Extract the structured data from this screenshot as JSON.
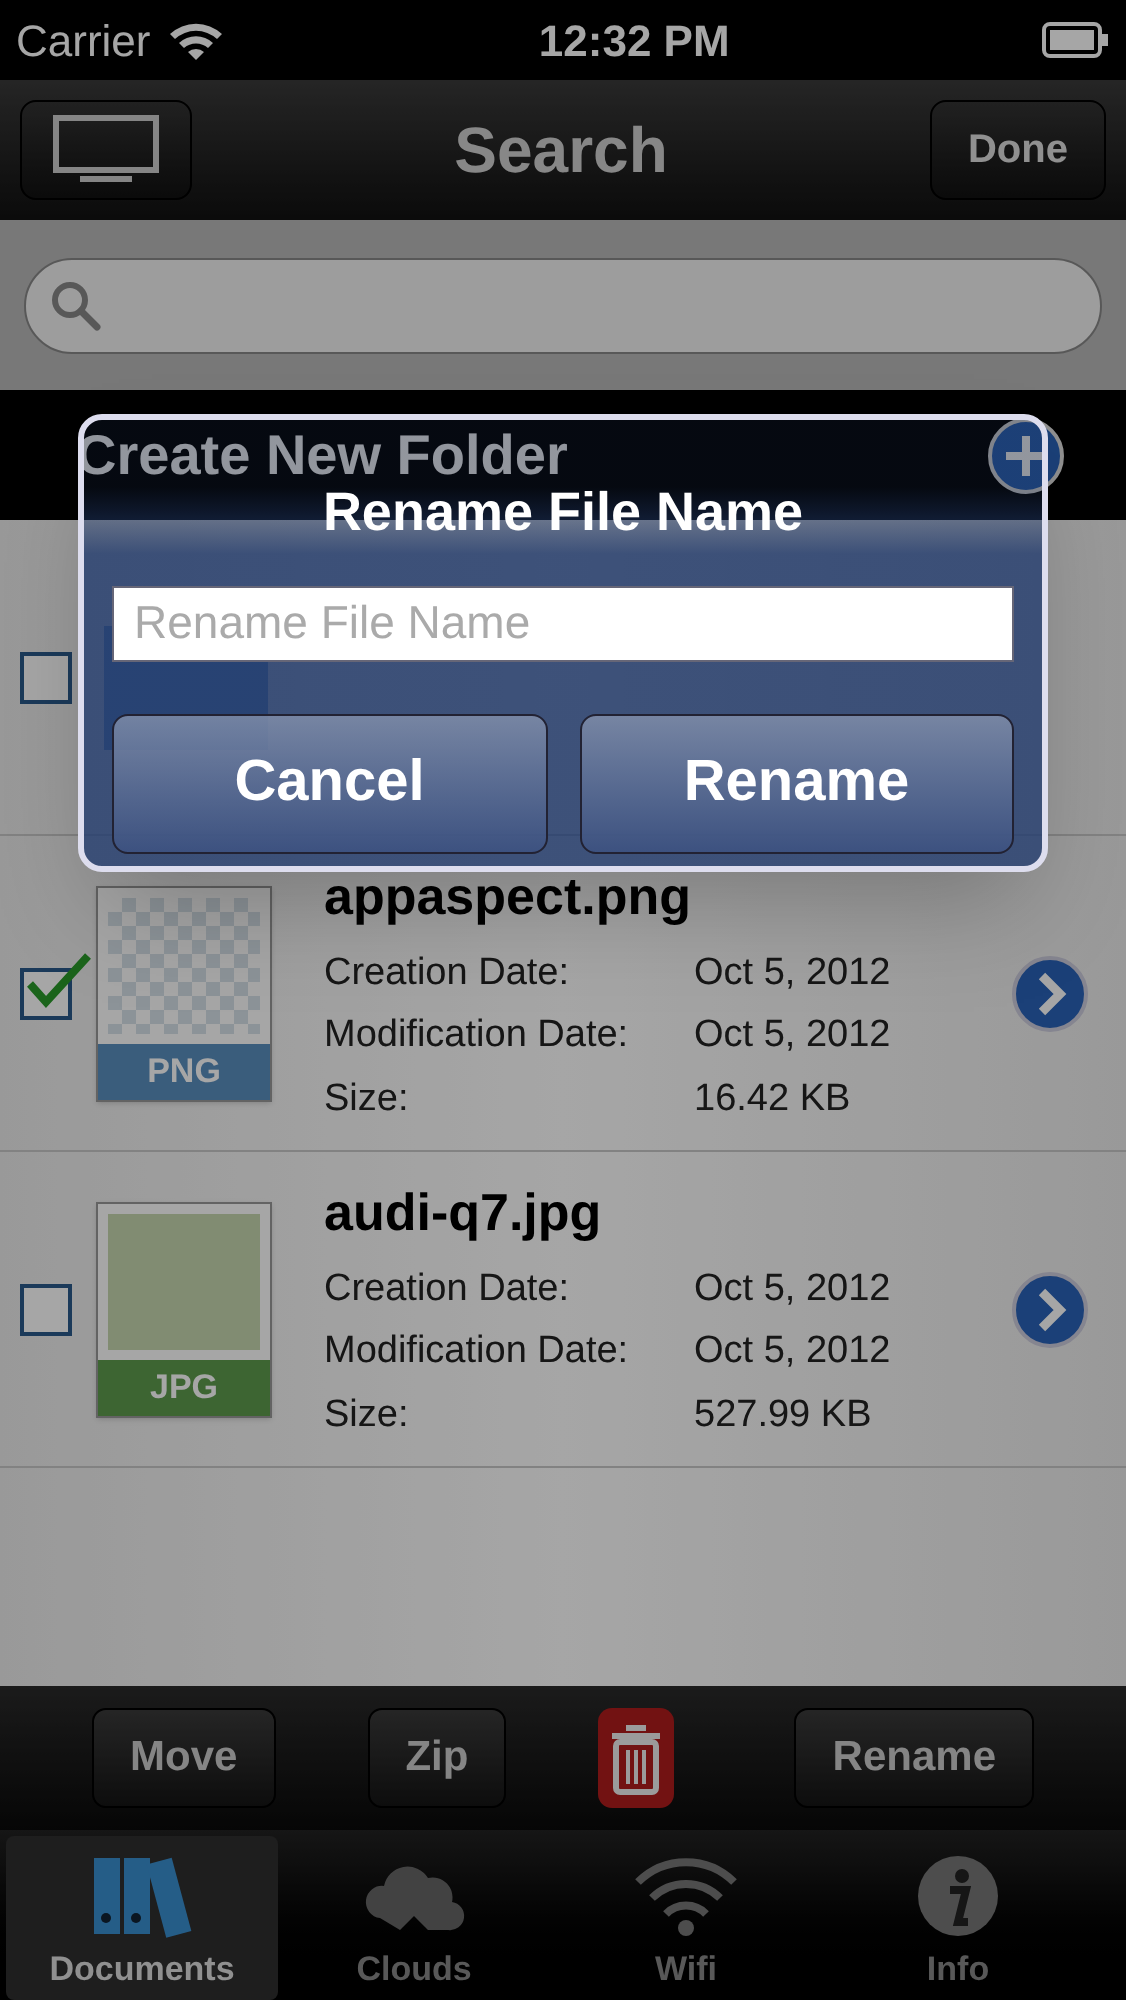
{
  "status_bar": {
    "carrier": "Carrier",
    "time": "12:32 PM"
  },
  "nav_bar": {
    "title": "Search",
    "done_button": "Done"
  },
  "create_folder": {
    "label": "Create New Folder"
  },
  "files": [
    {
      "kind": "folder",
      "checked": false
    },
    {
      "kind": "image",
      "badge": "PNG",
      "name": "appaspect.png",
      "checked": true,
      "fields": [
        {
          "label": "Creation Date:",
          "value": "Oct 5, 2012"
        },
        {
          "label": "Modification Date:",
          "value": "Oct 5, 2012"
        },
        {
          "label": "Size:",
          "value": "16.42 KB"
        }
      ]
    },
    {
      "kind": "photo",
      "badge": "JPG",
      "name": "audi-q7.jpg",
      "checked": false,
      "fields": [
        {
          "label": "Creation Date:",
          "value": "Oct 5, 2012"
        },
        {
          "label": "Modification Date:",
          "value": "Oct 5, 2012"
        },
        {
          "label": "Size:",
          "value": "527.99 KB"
        }
      ]
    }
  ],
  "toolbar": [
    {
      "kind": "text",
      "label": "Move"
    },
    {
      "kind": "text",
      "label": "Zip"
    },
    {
      "kind": "trash"
    },
    {
      "kind": "text",
      "label": "Rename"
    }
  ],
  "tabs": [
    {
      "kind": "documents",
      "label": "Documents",
      "selected": true
    },
    {
      "kind": "clouds",
      "label": "Clouds",
      "selected": false
    },
    {
      "kind": "wifi",
      "label": "Wifi",
      "selected": false
    },
    {
      "kind": "info",
      "label": "Info",
      "selected": false
    }
  ],
  "dialog": {
    "title": "Rename File Name",
    "placeholder": "Rename File Name",
    "buttons": [
      "Cancel",
      "Rename"
    ]
  }
}
